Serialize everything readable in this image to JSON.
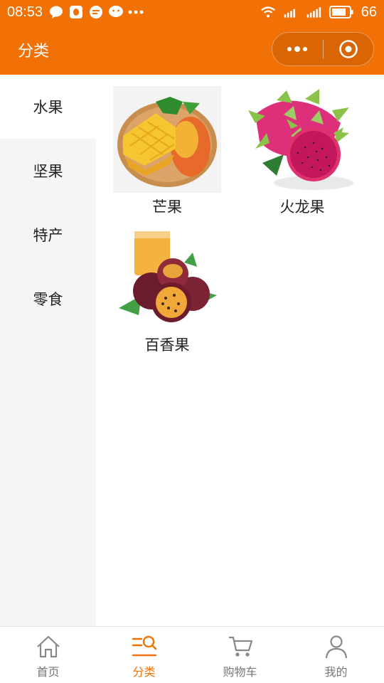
{
  "status_bar": {
    "time": "08:53",
    "battery": "66",
    "icons": [
      "chat-icon",
      "qq-icon",
      "message-icon",
      "wechat-icon",
      "more-dots-icon",
      "wifi-icon",
      "signal-3g-icon",
      "signal-icon",
      "battery-icon"
    ]
  },
  "nav": {
    "title": "分类",
    "capsule": {
      "more": "more-dots-icon",
      "close": "target-circle-icon"
    }
  },
  "sidebar": {
    "items": [
      {
        "label": "水果",
        "active": true
      },
      {
        "label": "坚果",
        "active": false
      },
      {
        "label": "特产",
        "active": false
      },
      {
        "label": "零食",
        "active": false
      }
    ]
  },
  "products": [
    {
      "name": "芒果"
    },
    {
      "name": "火龙果"
    },
    {
      "name": "百香果"
    }
  ],
  "tabbar": {
    "tabs": [
      {
        "label": "首页",
        "icon": "home-icon",
        "active": false
      },
      {
        "label": "分类",
        "icon": "category-icon",
        "active": true
      },
      {
        "label": "购物车",
        "icon": "cart-icon",
        "active": false
      },
      {
        "label": "我的",
        "icon": "user-icon",
        "active": false
      }
    ]
  },
  "colors": {
    "accent": "#f27106",
    "sidebar_bg": "#f5f5f5",
    "text": "#222222"
  }
}
